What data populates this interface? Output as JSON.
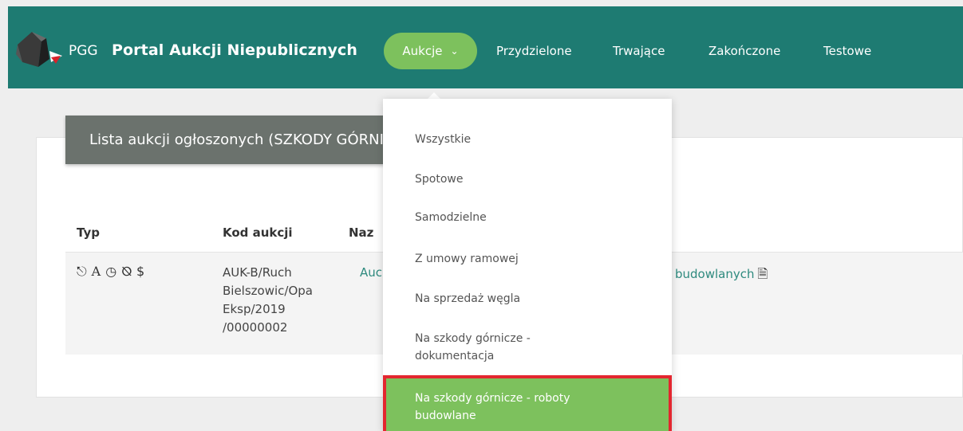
{
  "header": {
    "brand_short": "PGG",
    "brand_title": "Portal Aukcji Niepublicznych",
    "nav": [
      {
        "label": "Aukcje",
        "active": true
      },
      {
        "label": "Przydzielone"
      },
      {
        "label": "Trwające"
      },
      {
        "label": "Zakończone"
      },
      {
        "label": "Testowe"
      }
    ]
  },
  "panel": {
    "title": "Lista aukcji ogłoszonych (SZKODY GÓRNICZE - ROBOTY BUDOWLANE)"
  },
  "table": {
    "columns": [
      "Typ",
      "Kod aukcji",
      "Naz"
    ],
    "rows": [
      {
        "type_icons": "⛭ A ◷ ⊘ $",
        "code_lines": [
          "AUK-B/Ruch",
          "Bielszowic/Opa",
          "Eksp/2019",
          "/00000002"
        ],
        "name_left": "Auc",
        "name_right": "budowlanych"
      }
    ]
  },
  "dropdown": {
    "items": [
      "Wszystkie",
      "Spotowe",
      "Samodzielne",
      "Z umowy ramowej",
      "Na sprzedaż węgla",
      "Na szkody górnicze - dokumentacja",
      "Na szkody górnicze - roboty budowlane"
    ],
    "selected_index": 6
  },
  "colors": {
    "header_bg": "#1e7b72",
    "accent_green": "#7dc15d",
    "highlight_border": "#e3262f",
    "link_teal": "#2e8a7e"
  },
  "icons": [
    "pgg-logo-icon",
    "chevron-down-icon",
    "lock-icon",
    "letter-a-icon",
    "clock-icon",
    "eye-slash-icon",
    "dollar-icon",
    "document-icon"
  ]
}
